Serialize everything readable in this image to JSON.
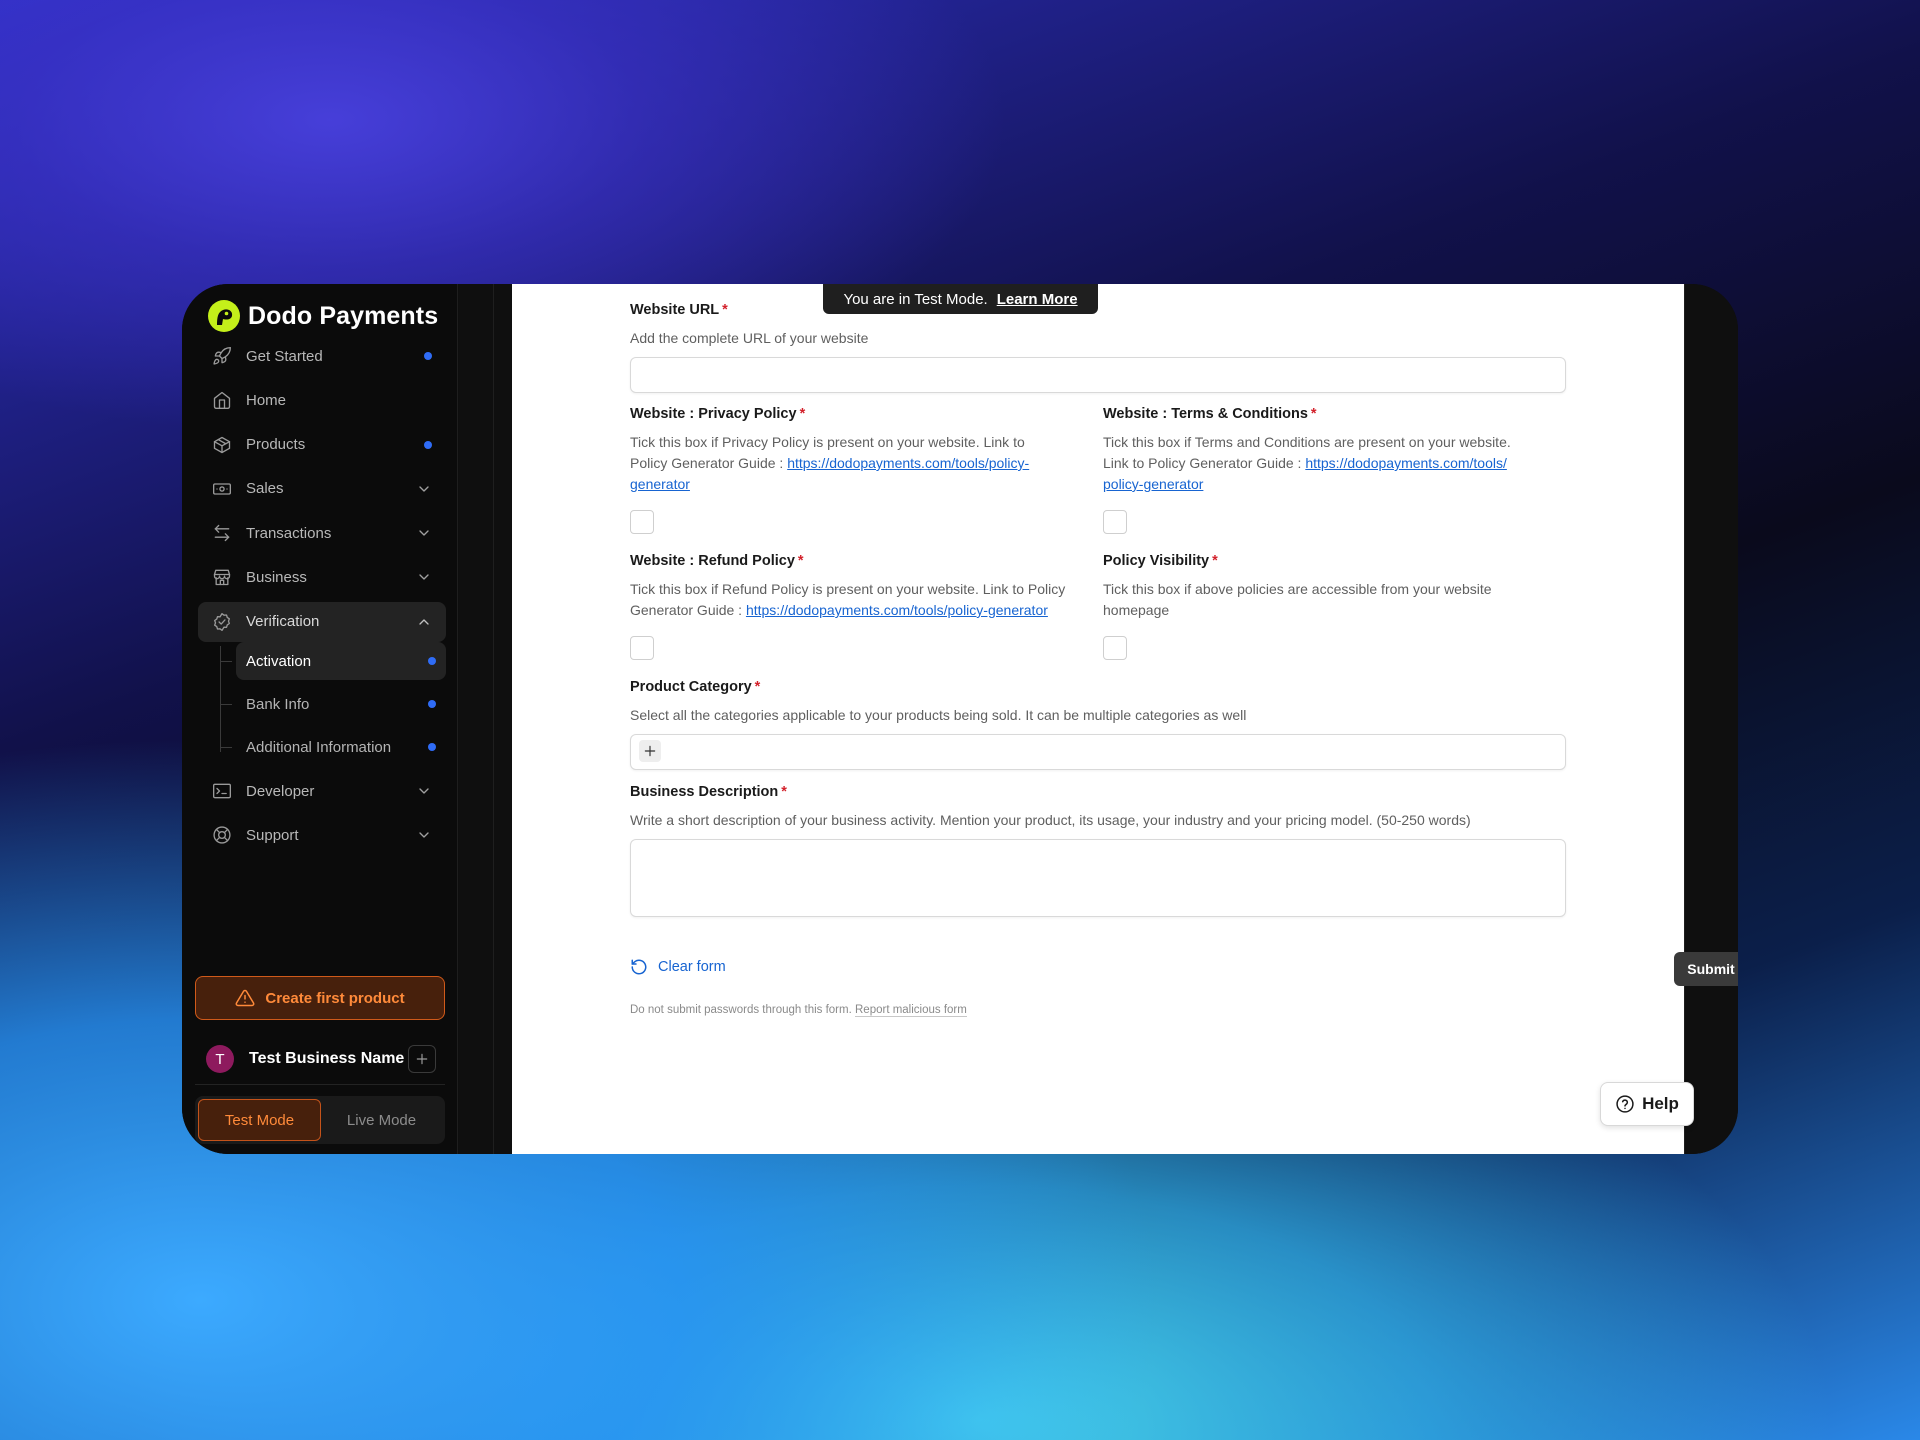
{
  "brand": {
    "name": "Dodo Payments",
    "logo_icon": "dodo-logo-icon",
    "accent": "#c4f01a"
  },
  "sidebar": {
    "items": [
      {
        "label": "Get Started",
        "icon": "rocket-icon",
        "dot": true
      },
      {
        "label": "Home",
        "icon": "home-icon"
      },
      {
        "label": "Products",
        "icon": "box-icon",
        "dot": true
      },
      {
        "label": "Sales",
        "icon": "banknote-icon",
        "chevron": "down"
      },
      {
        "label": "Transactions",
        "icon": "arrows-icon",
        "chevron": "down"
      },
      {
        "label": "Business",
        "icon": "store-icon",
        "chevron": "down"
      },
      {
        "label": "Verification",
        "icon": "badge-check-icon",
        "chevron": "up",
        "open": true
      },
      {
        "label": "Developer",
        "icon": "terminal-icon",
        "chevron": "down"
      },
      {
        "label": "Support",
        "icon": "lifebuoy-icon",
        "chevron": "down"
      }
    ],
    "verification_sub": [
      {
        "label": "Activation",
        "active": true,
        "dot": true
      },
      {
        "label": "Bank Info",
        "dot": true
      },
      {
        "label": "Additional Information",
        "dot": true
      }
    ],
    "create_button": "Create first product",
    "business": {
      "avatar_letter": "T",
      "name": "Test Business Name"
    },
    "modes": {
      "test": "Test Mode",
      "live": "Live Mode",
      "selected": "Test Mode"
    }
  },
  "banner": {
    "text": "You are in Test Mode.",
    "link": "Learn More"
  },
  "form": {
    "website_url": {
      "label": "Website URL",
      "help": "Add the complete URL of your website",
      "value": ""
    },
    "privacy": {
      "label": "Website : Privacy Policy",
      "help_line1": "Tick this box if Privacy Policy is present on your website. Link to",
      "help_line2": "Policy Generator Guide : ",
      "link_a": "https://dodopayments.com/tools/policy-",
      "link_b": "generator",
      "checked": false
    },
    "terms": {
      "label": "Website : Terms & Conditions",
      "help_line1": "Tick this box if Terms and Conditions are present on your website.",
      "help_line2": "Link to Policy Generator Guide : ",
      "link_a": "https://dodopayments.com/tools/",
      "link_b": "policy-generator",
      "checked": false
    },
    "refund": {
      "label": "Website : Refund Policy",
      "help_line1": "Tick this box if Refund Policy is present on your website. Link to Policy",
      "help_line2": "Generator Guide : ",
      "link": "https://dodopayments.com/tools/policy-generator",
      "checked": false
    },
    "visibility": {
      "label": "Policy Visibility",
      "help_line1": "Tick this box if above policies are accessible from your website",
      "help_line2": "homepage",
      "checked": false
    },
    "category": {
      "label": "Product Category",
      "help": "Select all the categories applicable to your products being sold. It can be multiple categories as well"
    },
    "description": {
      "label": "Business Description",
      "help": "Write a short description of your business activity. Mention your product, its usage, your industry and your pricing model. (50-250 words)",
      "value": ""
    },
    "required_mark": "*",
    "clear_label": "Clear form",
    "submit_label": "Submit",
    "footnote_prefix": "Do not submit passwords through this form. ",
    "footnote_link": "Report malicious form"
  },
  "help_button": "Help"
}
